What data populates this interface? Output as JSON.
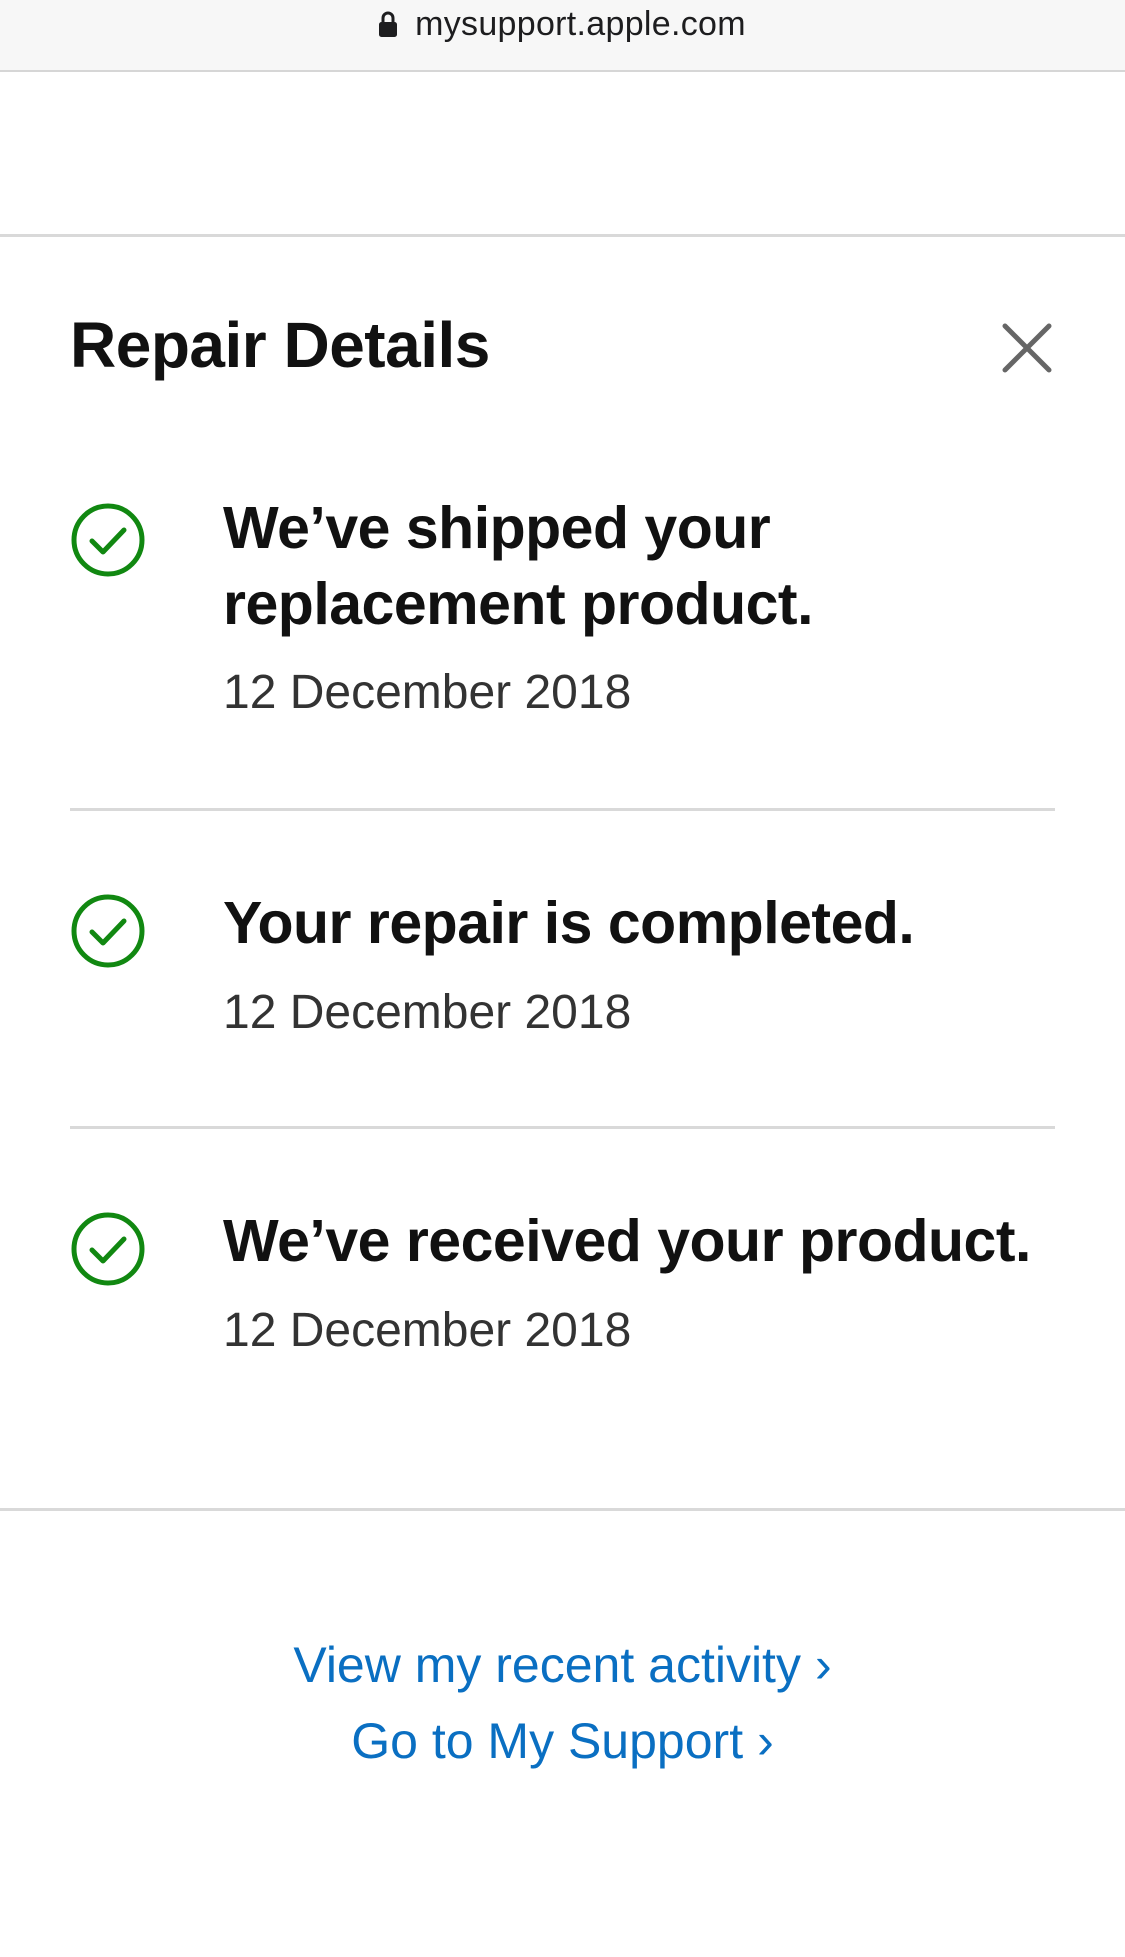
{
  "browser": {
    "url": "mysupport.apple.com",
    "lock_icon": "lock-icon"
  },
  "header": {
    "title": "Repair Details",
    "close_icon": "close-icon"
  },
  "colors": {
    "check_green": "#118811",
    "link_blue": "#0a6fc2"
  },
  "steps": [
    {
      "icon": "check-circle-icon",
      "title": "We’ve shipped your replacement product.",
      "date": "12 December 2018"
    },
    {
      "icon": "check-circle-icon",
      "title": "Your repair is completed.",
      "date": "12 December 2018"
    },
    {
      "icon": "check-circle-icon",
      "title": "We’ve received your product.",
      "date": "12 December 2018"
    }
  ],
  "links": {
    "recent_activity": "View my recent activity",
    "my_support": "Go to My Support",
    "chevron": "›"
  }
}
